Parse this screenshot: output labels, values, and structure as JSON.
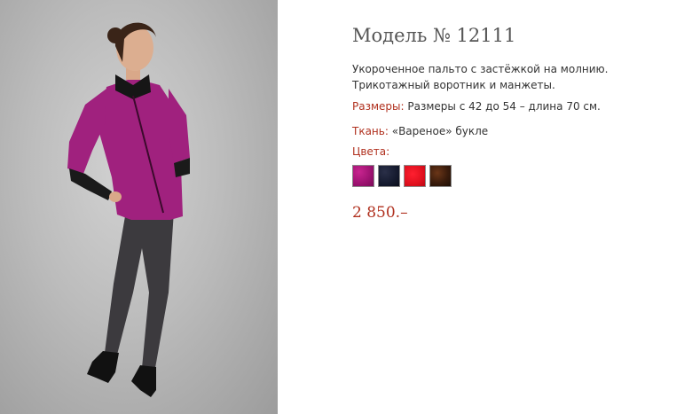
{
  "product": {
    "title": "Модель № 12111",
    "description": "Укороченное пальто с застёжкой на молнию. Трикотажный воротник и манжеты.",
    "sizes_label": "Размеры:",
    "sizes_value": "Размеры с 42 до 54 – длина 70 см.",
    "fabric_label": "Ткань:",
    "fabric_value": "«Вареное» букле",
    "colors_label": "Цвета:",
    "swatches": [
      {
        "name": "magenta",
        "color": "#9c1270"
      },
      {
        "name": "navy",
        "color": "#151a2e"
      },
      {
        "name": "red",
        "color": "#e0101e"
      },
      {
        "name": "brown",
        "color": "#3a1c0c"
      }
    ],
    "price": "2 850.–"
  },
  "theme": {
    "accent_color": "#b0301e",
    "title_color": "#555555",
    "coat_color": "#a0217e"
  }
}
